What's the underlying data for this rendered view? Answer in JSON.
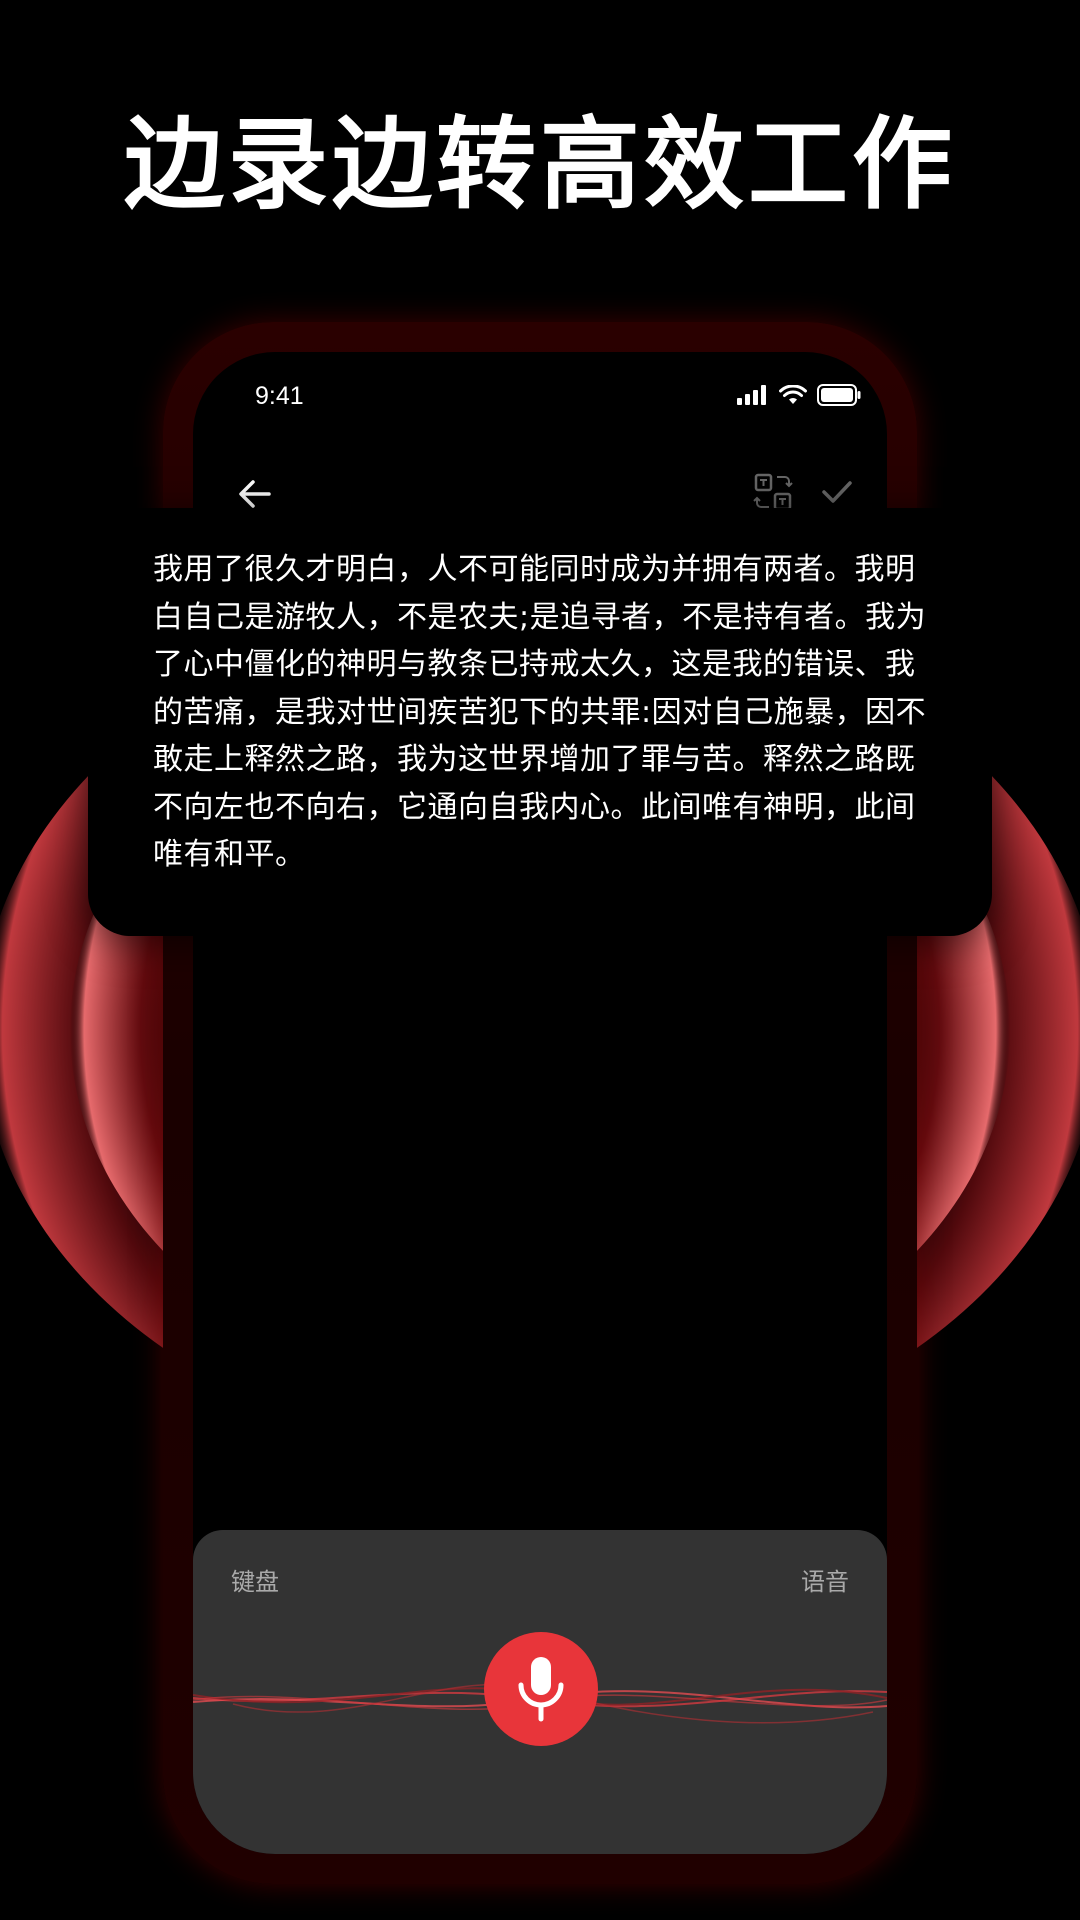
{
  "headline": "边录边转高效工作",
  "status_bar": {
    "time": "9:41"
  },
  "nav": {
    "back_icon": "arrow-left-icon",
    "translate_icon": "translate-icon",
    "confirm_icon": "checkmark-icon"
  },
  "transcript": {
    "text": "我用了很久才明白，人不可能同时成为并拥有两者。我明白自己是游牧人，不是农夫;是追寻者，不是持有者。我为了心中僵化的神明与教条已持戒太久，这是我的错误、我的苦痛，是我对世间疾苦犯下的共罪:因对自己施暴，因不敢走上释然之路，我为这世界增加了罪与苦。释然之路既不向左也不向右，它通向自我内心。此间唯有神明，此间唯有和平。"
  },
  "input_panel": {
    "keyboard_label": "键盘",
    "voice_label": "语音",
    "mic_icon": "microphone-icon"
  },
  "colors": {
    "accent": "#e8353a",
    "panel": "#333333",
    "background": "#000000"
  }
}
